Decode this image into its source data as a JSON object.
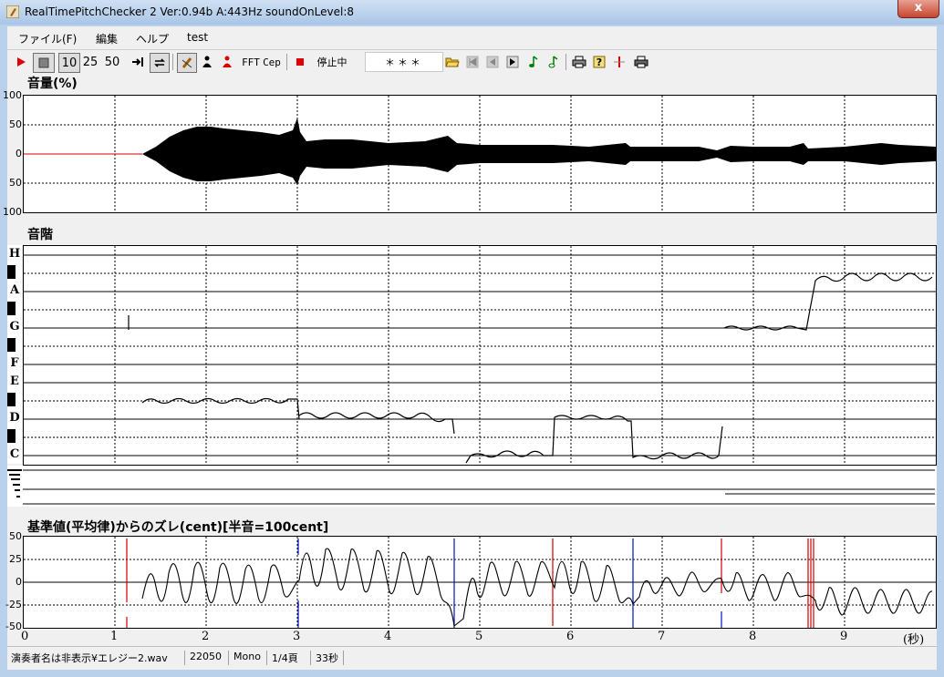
{
  "window": {
    "title": "RealTimePitchChecker 2    Ver:0.94b         A:443Hz    soundOnLevel:8",
    "close_label": "x"
  },
  "menu": [
    {
      "label": "ファイル(F)"
    },
    {
      "label": "編集"
    },
    {
      "label": "ヘルプ"
    },
    {
      "label": "test"
    }
  ],
  "toolbar": {
    "speed_10": "10",
    "speed_25": "25",
    "speed_50": "50",
    "fft_label": "FFT",
    "cep_label": "Cep",
    "status_text": "停止中",
    "display_field": "＊＊＊"
  },
  "volume_panel": {
    "title": "音量(%)",
    "y_ticks": [
      "100",
      "50",
      "0",
      "50",
      "100"
    ]
  },
  "scale_panel": {
    "title": "音階",
    "notes": [
      "H",
      "A",
      "G",
      "F",
      "E",
      "D",
      "C"
    ]
  },
  "deviation_panel": {
    "title": "基準値(平均律)からのズレ(cent)[半音=100cent]",
    "y_ticks": [
      "50",
      "25",
      "0",
      "-25",
      "-50"
    ]
  },
  "x_axis": {
    "ticks": [
      "0",
      "1",
      "2",
      "3",
      "4",
      "5",
      "6",
      "7",
      "8",
      "9"
    ],
    "unit": "(秒)"
  },
  "statusbar": {
    "file": "演奏者名は非表示¥エレジー2.wav",
    "rate": "22050",
    "channels": "Mono",
    "page": "1/4頁",
    "duration": "33秒"
  },
  "colors": {
    "accent_red": "#d00000",
    "marker_blue": "#0010c0"
  }
}
